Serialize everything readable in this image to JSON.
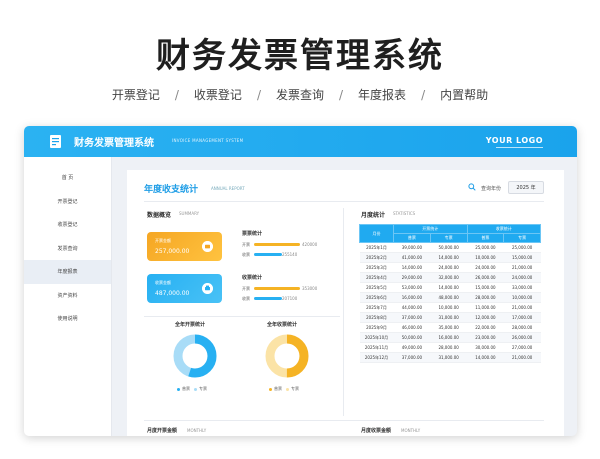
{
  "hero": {
    "title": "财务发票管理系统",
    "nav": [
      "开票登记",
      "收票登记",
      "发票查询",
      "年度报表",
      "内置帮助"
    ]
  },
  "topbar": {
    "title": "财务发票管理系统",
    "subtitle": "INVOICE MANAGEMENT SYSTEM",
    "logo_text": "YOUR LOGO"
  },
  "sidebar": {
    "items": [
      {
        "label": "首 页"
      },
      {
        "label": "开票登记"
      },
      {
        "label": "收票登记"
      },
      {
        "label": "发票查询"
      },
      {
        "label": "年度报表"
      },
      {
        "label": "资产资料"
      },
      {
        "label": "使用说明"
      }
    ],
    "active_index": 4
  },
  "main": {
    "title": "年度收支统计",
    "title_sub": "ANNUAL REPORT",
    "year_label": "查询年份",
    "year_value": "2025 年",
    "summary": {
      "title": "数据概览",
      "title_sub": "SUMMARY",
      "cards": [
        {
          "label": "开票金额",
          "value": "257,000.00",
          "color": "#f5a623"
        },
        {
          "label": "收票金额",
          "value": "487,000.00",
          "color": "#27b0f2"
        }
      ],
      "invoice_stats": {
        "title": "票票统计",
        "rows": [
          {
            "label": "开票",
            "value": "420000",
            "fraction": 1.0,
            "color": "#f5b324"
          },
          {
            "label": "收票",
            "value": "255140",
            "fraction": 0.6,
            "color": "#27b0f2"
          }
        ]
      },
      "receipt_stats": {
        "title": "收票统计",
        "rows": [
          {
            "label": "开票",
            "value": "353000",
            "fraction": 1.0,
            "color": "#f5b324"
          },
          {
            "label": "收票",
            "value": "207100",
            "fraction": 0.6,
            "color": "#27b0f2"
          }
        ]
      }
    },
    "donuts": [
      {
        "title": "全年开票统计",
        "legend": [
          "普票",
          "专票"
        ],
        "colors": [
          "#27b0f2",
          "#a8dcf7"
        ],
        "share": 0.55
      },
      {
        "title": "全年收票统计",
        "legend": [
          "普票",
          "专票"
        ],
        "colors": [
          "#f5b324",
          "#fbe3a6"
        ],
        "share": 0.5
      }
    ],
    "monthly": {
      "title": "月度统计",
      "title_sub": "STATISTICS",
      "group_headers": [
        "开票统计",
        "收票统计"
      ],
      "month_header": "月份",
      "sub_headers": [
        "普票",
        "专票",
        "普票",
        "专票"
      ],
      "rows": [
        [
          "2025年1月",
          "39,000.00",
          "50,000.00",
          "25,000.00",
          "25,000.00"
        ],
        [
          "2025年2月",
          "41,000.00",
          "14,000.00",
          "10,000.00",
          "15,000.00"
        ],
        [
          "2025年3月",
          "14,000.00",
          "24,000.00",
          "24,000.00",
          "21,000.00"
        ],
        [
          "2025年4月",
          "29,000.00",
          "32,000.00",
          "26,000.00",
          "24,000.00"
        ],
        [
          "2025年5月",
          "53,000.00",
          "14,000.00",
          "15,000.00",
          "33,000.00"
        ],
        [
          "2025年6月",
          "16,000.00",
          "48,000.00",
          "28,000.00",
          "10,000.00"
        ],
        [
          "2025年7月",
          "44,000.00",
          "10,000.00",
          "11,000.00",
          "21,000.00"
        ],
        [
          "2025年8月",
          "37,000.00",
          "31,000.00",
          "12,000.00",
          "17,000.00"
        ],
        [
          "2025年9月",
          "46,000.00",
          "35,000.00",
          "22,000.00",
          "28,000.00"
        ],
        [
          "2025年10月",
          "50,000.00",
          "16,000.00",
          "23,000.00",
          "26,000.00"
        ],
        [
          "2025年11月",
          "49,000.00",
          "28,000.00",
          "30,000.00",
          "27,000.00"
        ],
        [
          "2025年12月",
          "37,000.00",
          "31,000.00",
          "14,000.00",
          "21,000.00"
        ]
      ]
    },
    "bottom": {
      "left_title": "月度开票金额",
      "left_sub": "MONTHLY",
      "right_title": "月度收票金额",
      "right_sub": "MONTHLY"
    }
  }
}
